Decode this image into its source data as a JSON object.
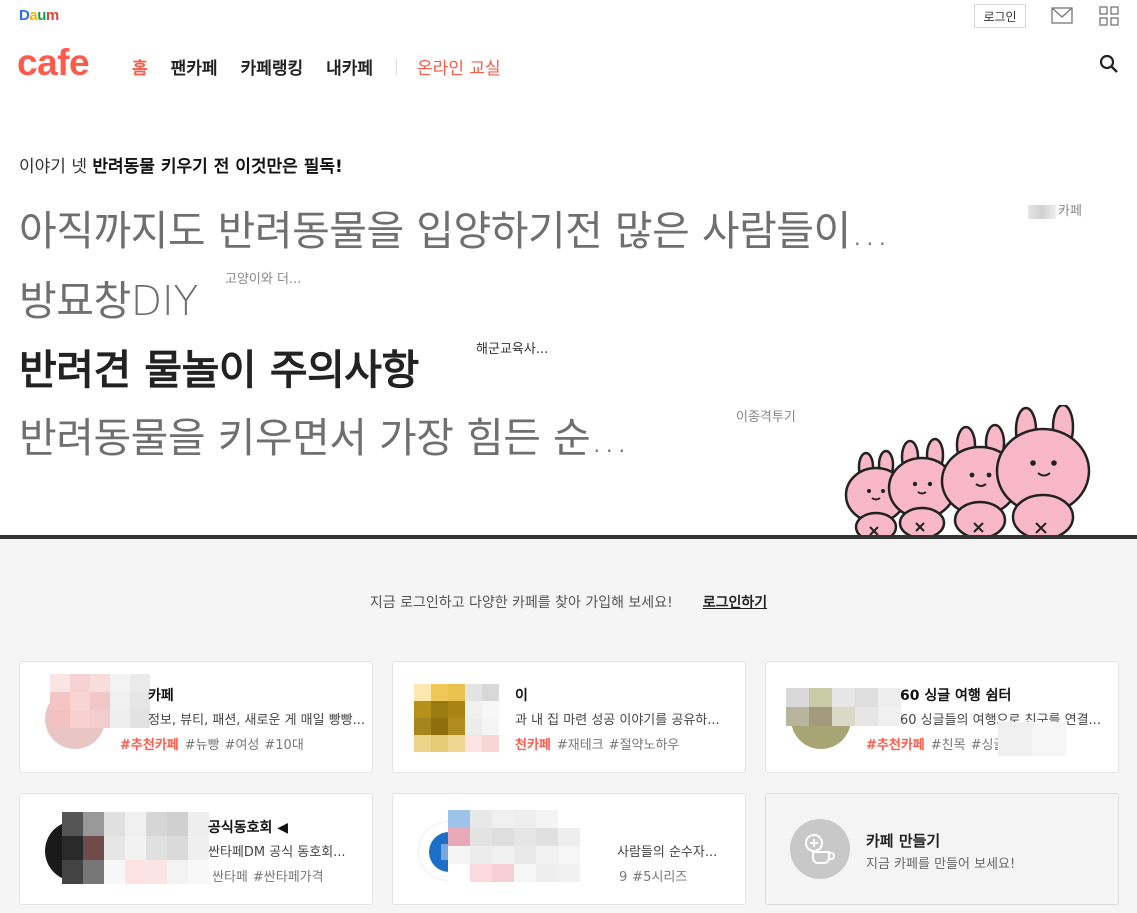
{
  "header": {
    "daum_logo": "Daum",
    "login_label": "로그인",
    "mail_icon": "mail-icon",
    "apps_icon": "apps-grid-icon",
    "search_icon": "search-icon"
  },
  "nav": {
    "logo": "cafe",
    "items": [
      {
        "label": "홈",
        "active": true
      },
      {
        "label": "팬카페",
        "active": false
      },
      {
        "label": "카페랭킹",
        "active": false
      },
      {
        "label": "내카페",
        "active": false
      }
    ],
    "online_class": "온라인 교실"
  },
  "story": {
    "title_prefix": "이야기 넷",
    "title_bold": "반려동물 키우기 전 이것만은 필독!",
    "lines": [
      {
        "text": "아직까지도 반려동물을 입양하기전 많은 사람들이...",
        "source": "카페"
      },
      {
        "text": "방묘창DIY",
        "source": "고양이와 더..."
      },
      {
        "text": "반려견 물놀이 주의사항",
        "source": "해군교육사..."
      },
      {
        "text": "반려동물을 키우면서 가장 힘든 순...",
        "source": "이종격투기"
      }
    ]
  },
  "login_prompt": {
    "message": "지금 로그인하고 다양한 카페를 찾아 가입해 보세요!",
    "link": "로그인하기"
  },
  "cafes": [
    {
      "name": "카페",
      "desc": "정보, 뷰티, 패션, 새로운 게 매일 빵빵...",
      "recommended": "#추천카페",
      "tags": [
        "#뉴빵",
        "#여성",
        "#10대"
      ]
    },
    {
      "name": "이",
      "desc": "과 내 집 마련 성공 이야기를 공유하...",
      "recommended": "천카페",
      "tags": [
        "#재테크",
        "#절약노하우"
      ]
    },
    {
      "name": "60 싱글 여행 쉼터",
      "desc": "60 싱글들의 여행으로 친구를 연결...",
      "recommended": "#추천카페",
      "tags": [
        "#친목",
        "#싱글"
      ]
    },
    {
      "name": "공식동호회 ◀",
      "desc": "싼타페DM 공식 동호회...",
      "recommended": "",
      "tags": [
        "싼타페",
        "#싼타페가격"
      ]
    },
    {
      "name": "",
      "desc": "사람들의 순수자...",
      "recommended": "",
      "tags": [
        "9",
        "#5시리즈"
      ]
    }
  ],
  "make_cafe": {
    "title": "카페 만들기",
    "subtitle": "지금 카페를 만들어 보세요!",
    "icon": "cup-plus-icon"
  },
  "colors": {
    "accent": "#ff5a4a",
    "divider": "#333333",
    "bottom_bg": "#f5f5f5"
  }
}
